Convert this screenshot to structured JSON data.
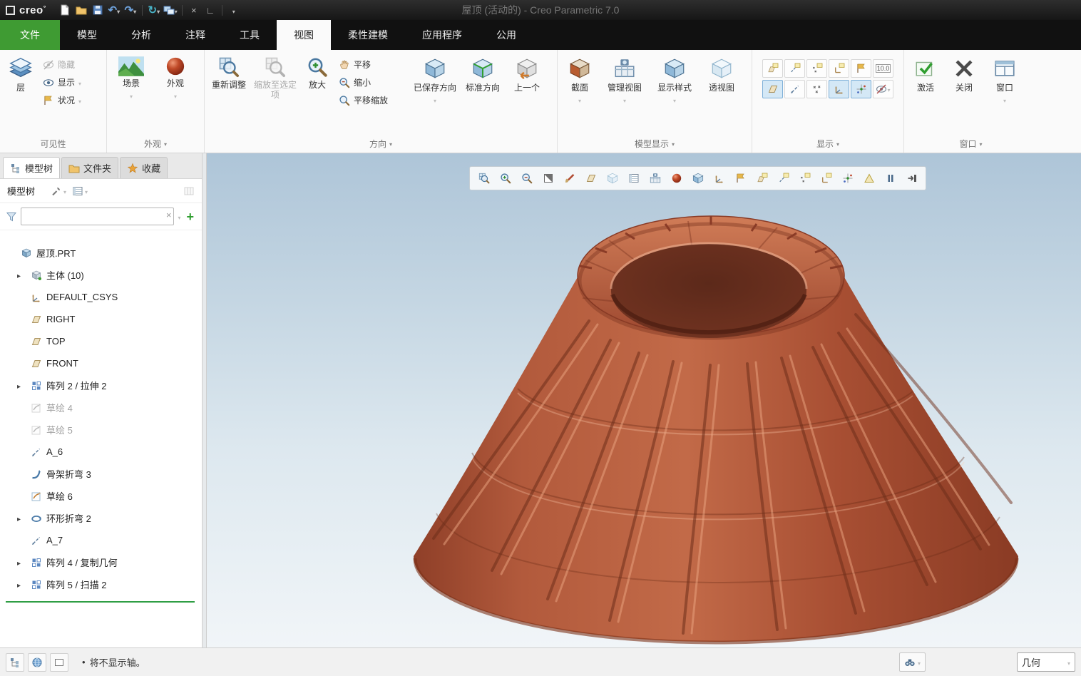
{
  "titlebar": {
    "app_name": "creo",
    "title": "屋顶 (活动的) - Creo Parametric 7.0"
  },
  "tabs": {
    "file": "文件",
    "model": "模型",
    "analysis": "分析",
    "annotate": "注释",
    "tools": "工具",
    "view": "视图",
    "flex": "柔性建模",
    "apps": "应用程序",
    "common": "公用"
  },
  "ribbon": {
    "visibility": {
      "group": "可见性",
      "layers": "层",
      "hide": "隐藏",
      "show": "显示",
      "status": "状况"
    },
    "appearance": {
      "group": "外观",
      "scene": "场景",
      "appearance": "外观"
    },
    "orientation": {
      "group": "方向",
      "refit": "重新调整",
      "zoom_sel": "缩放至选定项",
      "zoom_in": "放大",
      "pan": "平移",
      "zoom_out": "缩小",
      "pan_zoom": "平移缩放",
      "saved": "已保存方向",
      "standard": "标准方向",
      "previous": "上一个"
    },
    "model_display": {
      "group": "模型显示",
      "section": "截面",
      "manage": "管理视图",
      "style": "显示样式",
      "perspective": "透视图"
    },
    "show_group": {
      "group": "显示",
      "dim_toggle": "10.0"
    },
    "window": {
      "group": "窗口",
      "activate": "激活",
      "close": "关闭",
      "window": "窗口"
    }
  },
  "navigator": {
    "tabs": {
      "model_tree": "模型树",
      "files": "文件夹",
      "favorites": "收藏"
    },
    "header": "模型树",
    "filter": {
      "value": ""
    }
  },
  "tree": {
    "items": [
      "屋顶.PRT",
      "主体 (10)",
      "DEFAULT_CSYS",
      "RIGHT",
      "TOP",
      "FRONT",
      "阵列 2 / 拉伸 2",
      "草绘 4",
      "草绘 5",
      "A_6",
      "骨架折弯 3",
      "草绘 6",
      "环形折弯 2",
      "A_7",
      "阵列 4 / 复制几何",
      "阵列 5 / 扫描 2"
    ]
  },
  "viewport": {
    "toolbar": [
      "box-zoom",
      "zoom-in",
      "zoom-out",
      "refit",
      "appearance-gallery",
      "datum-plane-display",
      "reorient-view",
      "saved-orientations",
      "view-manager",
      "render-appearance",
      "display-style",
      "datum-display-filter",
      "annotation-display",
      "plane-tag-display",
      "axis-tag-display",
      "point-tag-display",
      "csys-tag-display",
      "spin-center",
      "perspective-warning",
      "pause",
      "exit-toolbar"
    ]
  },
  "statusbar": {
    "bullet": "•",
    "message": "将不显示轴。",
    "filter": "几何"
  },
  "icons": {
    "magnifier": "circle+handle svg",
    "layers": "stacked parallelograms",
    "scene": "landscape thumbnail",
    "appearance-sphere": "dark red sphere",
    "cube": "isometric cube",
    "eye": "ellipse+pupil",
    "hand": "pan hand",
    "check": "green check",
    "close-x": "bold x",
    "window-panes": "split rect",
    "funnel": "filter funnel",
    "binoculars": "search binoculars",
    "globe": "blue globe",
    "caret": "▾",
    "expand-arrow": "▸"
  }
}
